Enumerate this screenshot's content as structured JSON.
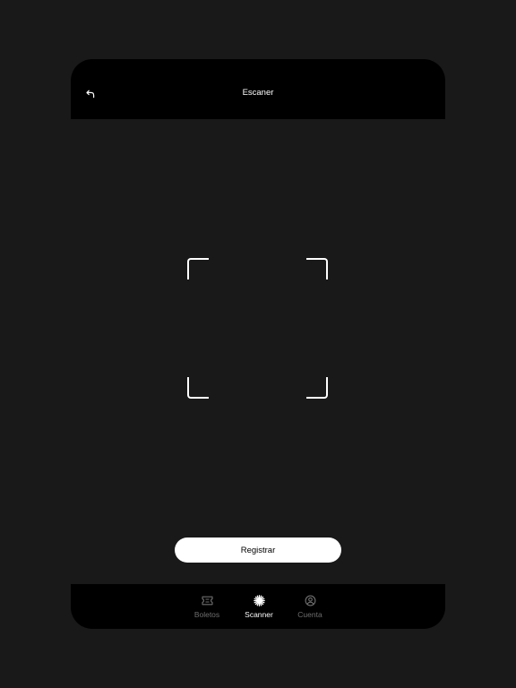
{
  "header": {
    "title": "Escaner",
    "back_icon": "back-arrow-icon"
  },
  "scanner": {
    "frame_icon": "scan-frame"
  },
  "actions": {
    "register_label": "Registrar"
  },
  "tabbar": {
    "tabs": [
      {
        "label": "Boletos",
        "icon": "ticket-icon",
        "active": false
      },
      {
        "label": "Scanner",
        "icon": "scanner-icon",
        "active": true
      },
      {
        "label": "Cuenta",
        "icon": "account-icon",
        "active": false
      }
    ]
  },
  "colors": {
    "background": "#191919",
    "bars": "#000000",
    "accent": "#ffffff",
    "inactive": "#6e6e6e"
  }
}
